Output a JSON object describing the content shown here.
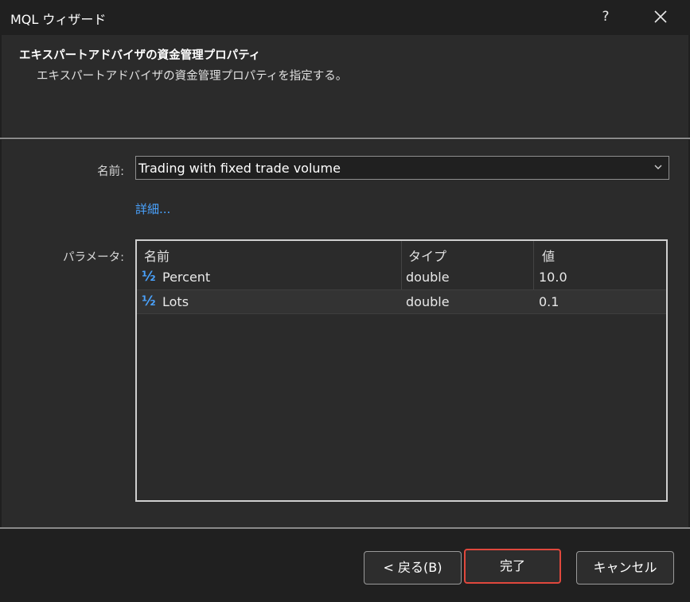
{
  "window": {
    "title": "MQL ウィザード",
    "help_label": "?"
  },
  "header": {
    "title": "エキスパートアドバイザの資金管理プロパティ",
    "subtitle": "エキスパートアドバイザの資金管理プロパティを指定する。"
  },
  "form": {
    "name_label": "名前:",
    "name_value": "Trading with fixed trade volume",
    "details_link": "詳細...",
    "params_label": "パラメータ:"
  },
  "params_table": {
    "columns": [
      "名前",
      "タイプ",
      "値"
    ],
    "rows": [
      {
        "icon": "½",
        "name": "Percent",
        "type": "double",
        "value": "10.0"
      },
      {
        "icon": "½",
        "name": "Lots",
        "type": "double",
        "value": "0.1"
      }
    ]
  },
  "buttons": {
    "back": "< 戻る(B)",
    "finish": "完了",
    "cancel": "キャンセル"
  },
  "colors": {
    "accent_link": "#4aa3ff",
    "focus_border": "#e0483d"
  }
}
